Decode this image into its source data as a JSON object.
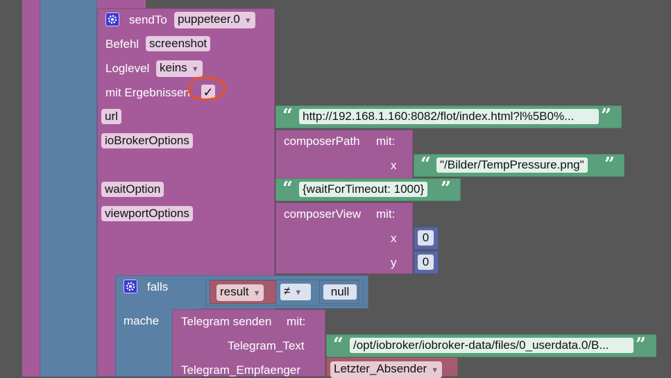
{
  "sendto": {
    "label": "sendTo",
    "instance": "puppeteer.0"
  },
  "befehl": {
    "label": "Befehl",
    "value": "screenshot"
  },
  "loglevel": {
    "label": "Loglevel",
    "value": "keins"
  },
  "mit_ergebnissen": {
    "label": "mit Ergebnissen",
    "checked": "✓"
  },
  "url": {
    "label": "url",
    "value": "http://192.168.1.160:8082/flot/index.html?l%5B0%..."
  },
  "iobroker_options": {
    "label": "ioBrokerOptions",
    "block_label": "composerPath",
    "mit": "mit:",
    "x_label": "x",
    "x_value": "\"/Bilder/TempPressure.png\""
  },
  "wait_option": {
    "label": "waitOption",
    "value": "{waitForTimeout: 1000}"
  },
  "viewport_options": {
    "label": "viewportOptions",
    "block_label": "composerView",
    "mit": "mit:",
    "x_label": "x",
    "x_value": "0",
    "y_label": "y",
    "y_value": "0"
  },
  "falls": {
    "label": "falls",
    "variable": "result",
    "operator": "≠",
    "null": "null"
  },
  "mache": {
    "label": "mache"
  },
  "telegram": {
    "label": "Telegram senden",
    "mit": "mit:",
    "text_label": "Telegram_Text",
    "text_value": "/opt/iobroker/iobroker-data/files/0_userdata.0/B...",
    "empf_label": "Telegram_Empfaenger",
    "empf_value": "Letzter_Absender"
  },
  "colors": {
    "background": "#575757",
    "procedure": "#a55b99",
    "text": "#5ba07c",
    "logic": "#5b80a5",
    "math": "#5b67a5",
    "annotation": "#e8541e"
  }
}
